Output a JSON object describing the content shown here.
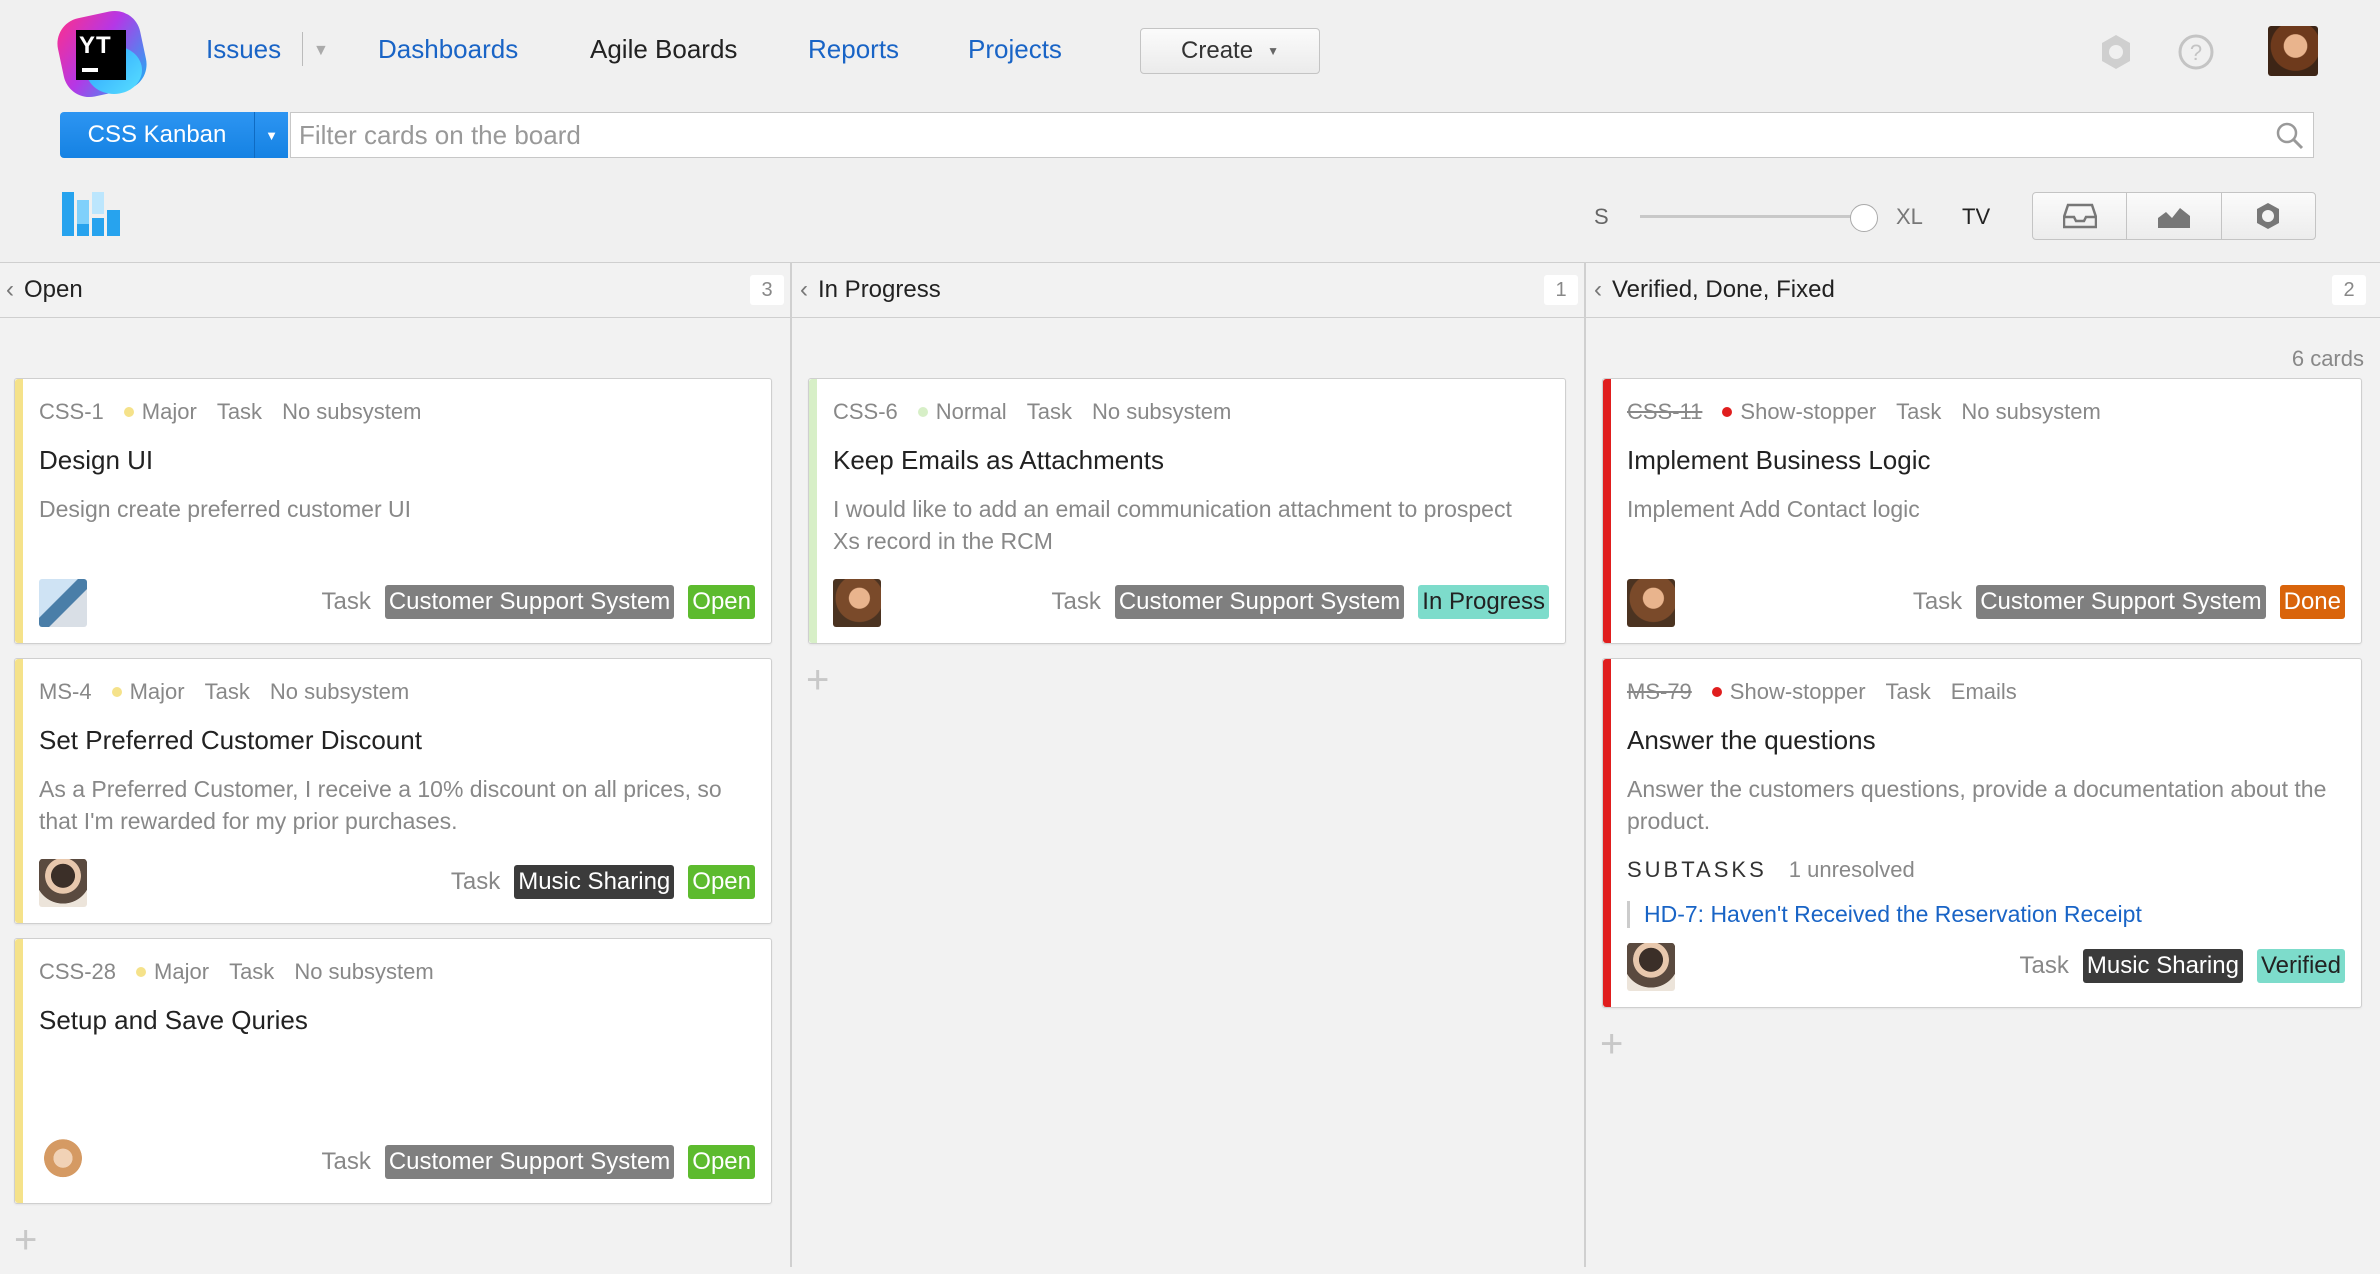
{
  "app": {
    "logo_text": "YT"
  },
  "nav": {
    "issues": "Issues",
    "dashboards": "Dashboards",
    "agile_boards": "Agile Boards",
    "reports": "Reports",
    "projects": "Projects",
    "create": "Create"
  },
  "icons": {
    "settings": "gear-icon",
    "help": "help-icon",
    "search": "search-icon",
    "board": "board-logo-icon",
    "backlog": "inbox-icon",
    "chart": "chart-icon",
    "board_settings": "gear-icon"
  },
  "toolbar": {
    "board_name": "CSS Kanban",
    "filter_placeholder": "Filter cards on the board",
    "size_small": "S",
    "size_large": "XL",
    "tv": "TV",
    "card_size_level": 1.0
  },
  "columns": [
    {
      "title": "Open",
      "count": "3"
    },
    {
      "title": "In Progress",
      "count": "1"
    },
    {
      "title": "Verified, Done, Fixed",
      "count": "2"
    }
  ],
  "cards_total": "6 cards",
  "colors": {
    "major": "#f5e28a",
    "normal": "#d7efc7",
    "show_stopper": "#e01e1e",
    "open": "#5dbb2e",
    "in_progress": "#7ddccb",
    "done": "#d9640b",
    "verified": "#7ddccb",
    "accent": "#1964c6"
  },
  "cards": [
    {
      "id": "CSS-1",
      "priority": "Major",
      "type": "Task",
      "subsystem": "No subsystem",
      "summary": "Design UI",
      "description": "Design create preferred customer UI",
      "footer_type": "Task",
      "tag": "Customer Support System",
      "state": "Open"
    },
    {
      "id": "MS-4",
      "priority": "Major",
      "type": "Task",
      "subsystem": "No subsystem",
      "summary": "Set Preferred Customer Discount",
      "description": "As a Preferred Customer, I receive a 10% discount on all prices, so that I'm rewarded for my prior purchases.",
      "footer_type": "Task",
      "tag": "Music Sharing",
      "state": "Open"
    },
    {
      "id": "CSS-28",
      "priority": "Major",
      "type": "Task",
      "subsystem": "No subsystem",
      "summary": "Setup and Save Quries",
      "description": "",
      "footer_type": "Task",
      "tag": "Customer Support System",
      "state": "Open"
    },
    {
      "id": "CSS-6",
      "priority": "Normal",
      "type": "Task",
      "subsystem": "No subsystem",
      "summary": "Keep Emails as Attachments",
      "description": "I would like to add an email communication attachment to prospect Xs record in the RCM",
      "footer_type": "Task",
      "tag": "Customer Support System",
      "state": "In Progress"
    },
    {
      "id": "CSS-11",
      "priority": "Show-stopper",
      "type": "Task",
      "subsystem": "No subsystem",
      "summary": "Implement Business Logic",
      "description": "Implement Add Contact logic",
      "footer_type": "Task",
      "tag": "Customer Support System",
      "state": "Done"
    },
    {
      "id": "MS-79",
      "priority": "Show-stopper",
      "type": "Task",
      "subsystem": "Emails",
      "summary": "Answer the questions",
      "description": "Answer the customers questions, provide a documentation about the product.",
      "subtasks_label": "SUBTASKS",
      "subtasks_count": "1 unresolved",
      "subtask": "HD-7: Haven't Received the Reservation Receipt",
      "footer_type": "Task",
      "tag": "Music Sharing",
      "state": "Verified"
    }
  ]
}
